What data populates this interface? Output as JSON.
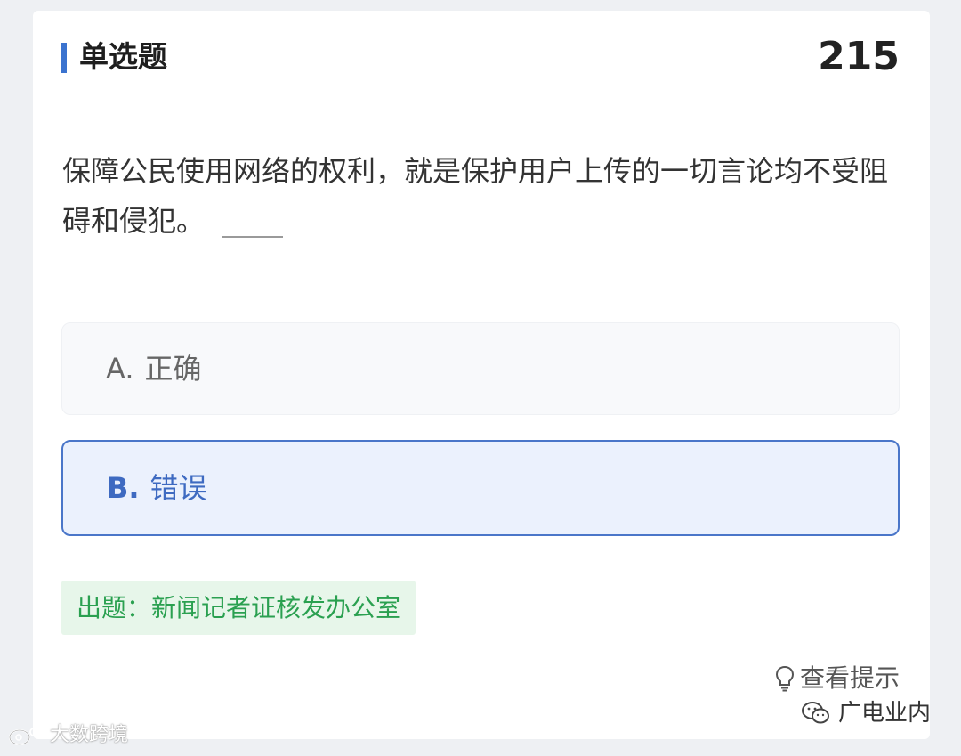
{
  "header": {
    "title": "单选题",
    "number": "215"
  },
  "question": {
    "text": "保障公民使用网络的权利，就是保护用户上传的一切言论均不受阻碍和侵犯。"
  },
  "options": [
    {
      "letter": "A.",
      "text": "正确",
      "selected": false
    },
    {
      "letter": "B.",
      "text": "错误",
      "selected": true
    }
  ],
  "source": {
    "label": "出题：新闻记者证核发办公室"
  },
  "hint": {
    "label": "查看提示",
    "icon": "lightbulb-icon"
  },
  "watermarks": {
    "right": "广电业内",
    "left": "大数跨境"
  },
  "colors": {
    "accent": "#3b73cf",
    "selected_bg": "#ebf1fd",
    "source_green": "#2aa050",
    "source_bg": "#e7f6ea"
  }
}
